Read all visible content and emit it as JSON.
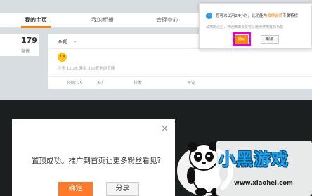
{
  "tabs": [
    {
      "label": "我的主页"
    },
    {
      "label": "我的相册"
    },
    {
      "label": "管理中心"
    }
  ],
  "stats": {
    "count": "179",
    "label": "微博"
  },
  "feed": {
    "filter": "全部",
    "meta": "今天 11:26 来自 360安全浏览器",
    "actions": [
      "阅读 29",
      "推广",
      "转发",
      "评论"
    ]
  },
  "tip_dialog": {
    "line1_a": "您可以试用24小时，此功能为",
    "line1_hl": "微博会员",
    "line1_b": "专属特权",
    "line2": "试用期过后，开通微博会员可以继续使用置顶功能",
    "ok_label": "确定",
    "cancel_label": "取消",
    "info_symbol": "i"
  },
  "modal": {
    "close_symbol": "×",
    "text": "置顶成功。推广到首页让更多粉丝看见?",
    "confirm_label": "确定",
    "share_label": "分享"
  },
  "watermark": {
    "title": "小黑游戏",
    "url": "www.xiaohei.com"
  },
  "colors": {
    "accent": "#ff8200",
    "highlight_box": "#e600c8",
    "info": "#2e9be6"
  }
}
